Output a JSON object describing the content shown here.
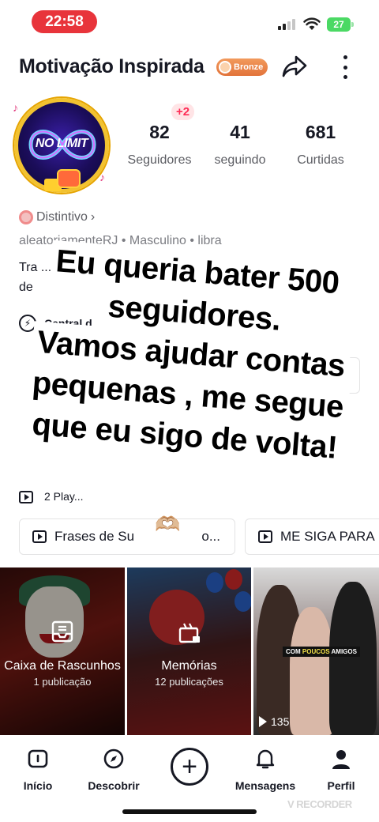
{
  "status_bar": {
    "time": "22:58",
    "battery": "27"
  },
  "header": {
    "title": "Motivação Inspirada",
    "badge": "Bronze"
  },
  "avatar": {
    "text": "NO LIMIT"
  },
  "stats": {
    "new_followers": "+2",
    "items": [
      {
        "value": "82",
        "label": "Seguidores"
      },
      {
        "value": "41",
        "label": "seguindo"
      },
      {
        "value": "681",
        "label": "Curtidas"
      }
    ]
  },
  "profile": {
    "badge_link": "Distintivo",
    "meta": "aleatoriamenteRJ  •  Masculino  •  libra",
    "bio_line1": "Tra                                          ...ulde  um passo",
    "bio_line2": "de",
    "central": "Central d"
  },
  "playlists": {
    "count": "2 Play...",
    "chips": [
      "Frases de Su",
      "o...",
      "ME SIGA PARA I"
    ]
  },
  "overlay": {
    "lines": [
      "Eu queria bater 500",
      "seguidores.",
      "Vamos ajudar contas",
      "pequenas , me segue",
      "que eu sigo de volta!"
    ],
    "emoji": "🫶🏼"
  },
  "grid": {
    "drafts": {
      "title": "Caixa de Rascunhos",
      "count": "1 publicação"
    },
    "memories": {
      "title": "Memórias",
      "count": "12 publicações"
    },
    "video": {
      "sticker_pre": "COM",
      "sticker_mid": "POUCOS",
      "sticker_post": "AMIGOS",
      "views": "135"
    }
  },
  "nav": {
    "items": [
      {
        "label": "Início",
        "icon": "home-icon"
      },
      {
        "label": "Descobrir",
        "icon": "compass-icon"
      },
      {
        "label": "",
        "icon": "plus-icon"
      },
      {
        "label": "Mensagens",
        "icon": "bell-icon"
      },
      {
        "label": "Perfil",
        "icon": "profile-icon"
      }
    ]
  },
  "watermark": "V RECORDER",
  "colors": {
    "accent": "#fe2c55",
    "time_pill": "#e8343b",
    "battery": "#4bd964",
    "bronze": "#e2733a",
    "avatar_ring": "#f2c230"
  }
}
